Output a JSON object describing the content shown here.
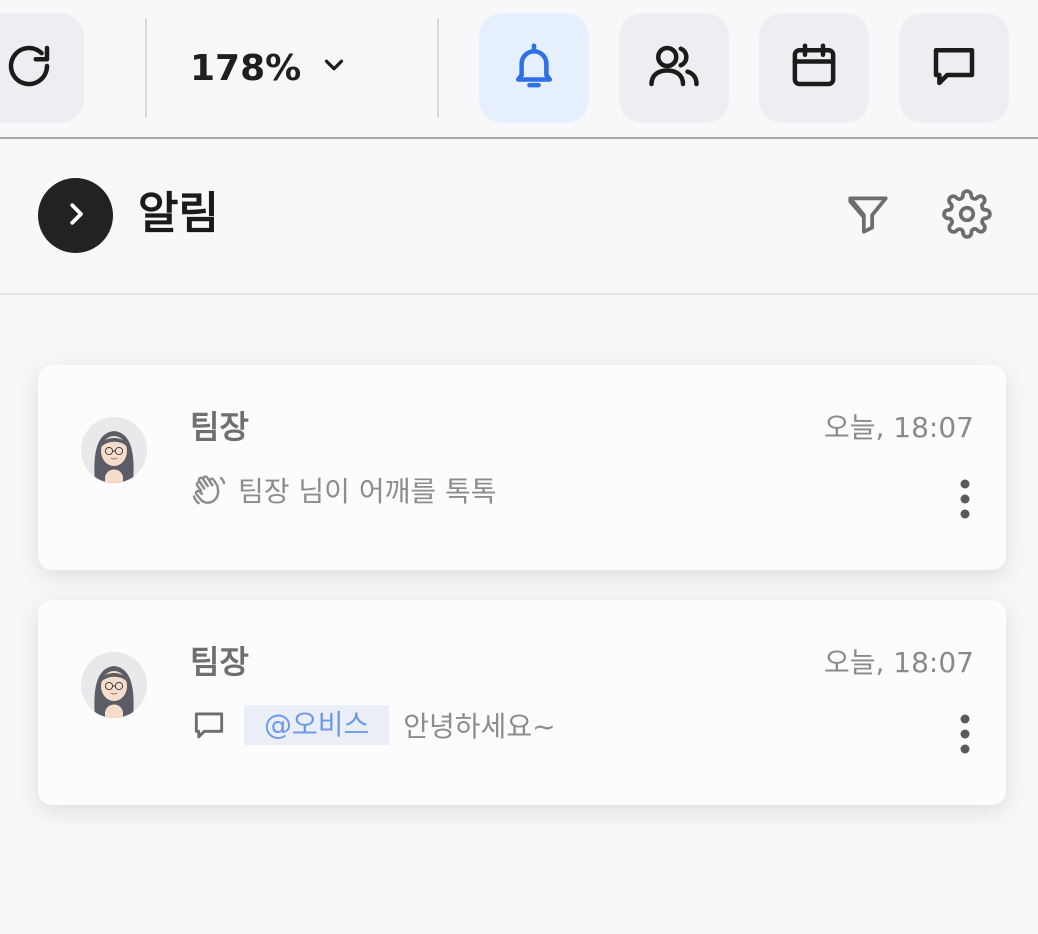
{
  "toolbar": {
    "zoom_value": "178%",
    "buttons": [
      {
        "icon": "refresh-icon"
      },
      {
        "icon": "bell-icon",
        "active": true
      },
      {
        "icon": "users-icon"
      },
      {
        "icon": "calendar-icon"
      },
      {
        "icon": "message-icon"
      }
    ]
  },
  "panel": {
    "title": "알림",
    "icons": [
      "chevron-right-icon",
      "filter-icon",
      "gear-icon"
    ]
  },
  "notifications": [
    {
      "sender": "팀장",
      "time": "오늘, 18:07",
      "type_icon": "wave-hand-icon",
      "message": "팀장 님이 어깨를 톡톡"
    },
    {
      "sender": "팀장",
      "time": "오늘, 18:07",
      "type_icon": "comment-icon",
      "mention": "@오비스",
      "message": "안녕하세요~"
    }
  ],
  "colors": {
    "accent": "#2f6fe8",
    "active_bg": "#e6effd",
    "mention_text": "#6f9ae8",
    "mention_bg": "#e9eef7"
  }
}
